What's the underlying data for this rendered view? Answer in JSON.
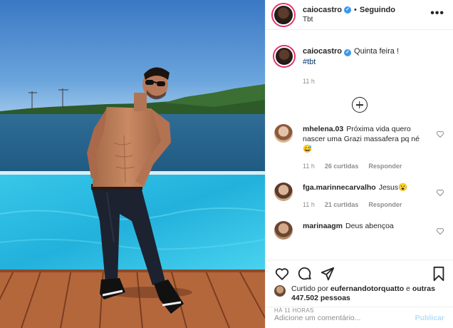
{
  "post": {
    "author": "caiocastro",
    "follow_separator": "•",
    "follow_status": "Seguindo",
    "location": "Tbt",
    "more_label": "•••",
    "caption": {
      "username": "caiocastro",
      "text": "Quinta feira !",
      "hashtag": "#tbt",
      "time": "11 h"
    },
    "comments": [
      {
        "username": "mhelena.03",
        "text": "Próxima vida quero nascer uma Grazi massafera pq né 😅",
        "time": "11 h",
        "likes": "26 curtidas",
        "reply": "Responder"
      },
      {
        "username": "fga.marinnecarvalho",
        "text": "Jesus😮",
        "time": "11 h",
        "likes": "21 curtidas",
        "reply": "Responder"
      },
      {
        "username": "marinaagm",
        "text": "Deus abençoa",
        "time": "",
        "likes": "",
        "reply": ""
      }
    ],
    "liked_by_prefix": "Curtido por",
    "liked_by_user": "eufernandotorquatto",
    "liked_by_connector": "e",
    "liked_by_others": "outras 447.502 pessoas",
    "posted_ago": "HÁ 11 HORAS",
    "comment_placeholder": "Adicione um comentário...",
    "publish_label": "Publicar"
  },
  "icons": {
    "like": "heart-icon",
    "comment": "comment-icon",
    "share": "share-icon",
    "save": "bookmark-icon",
    "load_more": "plus-circle-icon"
  },
  "colors": {
    "verified": "#3897f0",
    "story_ring": "#e1306c",
    "hashtag": "#00376b",
    "muted": "#8e8e8e",
    "publish_disabled": "#b2dffc"
  }
}
